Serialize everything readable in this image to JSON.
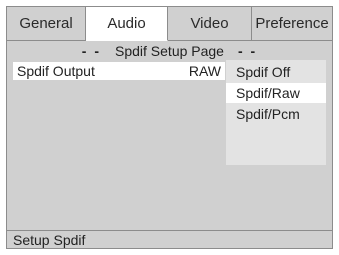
{
  "tabs": [
    {
      "label": "General",
      "active": false
    },
    {
      "label": "Audio",
      "active": true
    },
    {
      "label": "Video",
      "active": false
    },
    {
      "label": "Preference",
      "active": false
    }
  ],
  "page": {
    "title": "Spdif Setup Page",
    "dots": "- -"
  },
  "setting": {
    "label": "Spdif  Output",
    "value": "RAW"
  },
  "options": [
    {
      "label": "Spdif Off",
      "selected": false
    },
    {
      "label": "Spdif/Raw",
      "selected": true
    },
    {
      "label": "Spdif/Pcm",
      "selected": false
    }
  ],
  "status": {
    "text": "Setup Spdif"
  },
  "colors": {
    "panel": "#d0d0d0",
    "highlight": "#ffffff",
    "options_bg": "#e3e3e3"
  }
}
